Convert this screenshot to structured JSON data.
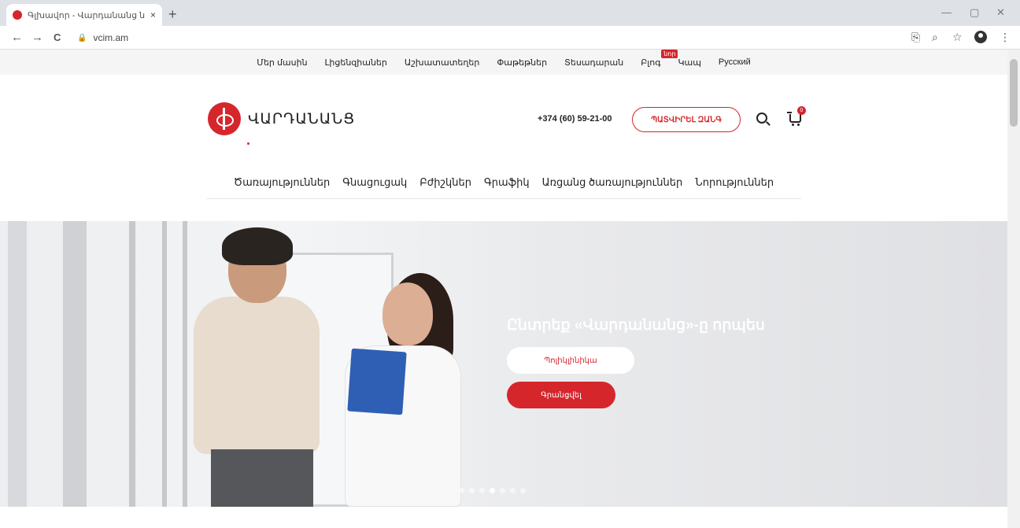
{
  "browser": {
    "tab_title": "Գլխավոր - Վարդանանց նորարարական բժշկական կենտրոն",
    "tab_close": "×",
    "new_tab": "+",
    "url": "vcim.am",
    "win_min": "—",
    "win_max": "▢",
    "win_close": "✕",
    "back": "←",
    "forward": "→",
    "reload": "C",
    "translate": "⎘",
    "zoom": "⌕",
    "star": "☆",
    "menu": "⋮"
  },
  "topnav": {
    "items": [
      {
        "label": "Մեր մասին"
      },
      {
        "label": "Լիցենզիաներ"
      },
      {
        "label": "Աշխատատեղեր"
      },
      {
        "label": "Փաթեթներ"
      },
      {
        "label": "Տեսադարան"
      },
      {
        "label": "Բլոգ",
        "badge": "նոր"
      },
      {
        "label": "Կապ"
      },
      {
        "label": "Русский"
      }
    ]
  },
  "header": {
    "logo_text": "ՎԱՐԴԱՆԱՆՑ",
    "phone": "+374 (60) 59-21-00",
    "order_button": "ՊԱՏՎԻՐԵԼ ԶԱՆԳ",
    "cart_count": "0"
  },
  "mainnav": {
    "items": [
      {
        "label": "Ծառայություններ"
      },
      {
        "label": "Գնացուցակ"
      },
      {
        "label": "Բժիշկներ"
      },
      {
        "label": "Գրաֆիկ"
      },
      {
        "label": "Առցանց ծառայություններ"
      },
      {
        "label": "Նորություններ"
      }
    ]
  },
  "hero": {
    "title": "Ընտրեք «Վարդանանց»-ը որպես",
    "button_primary": "Պոլիկլինիկա",
    "button_secondary": "Գրանցվել",
    "slide_count": 7,
    "active_slide": 4
  },
  "colors": {
    "brand": "#d5262c"
  }
}
